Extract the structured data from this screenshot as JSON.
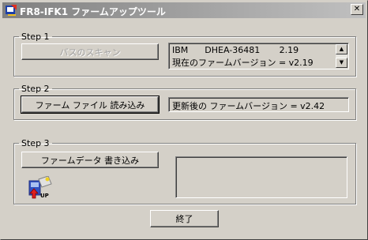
{
  "window": {
    "title": "FR8-IFK1 ファームアップツール",
    "close_glyph": "✕"
  },
  "step1": {
    "legend": "Step 1",
    "scan_button": "バスのスキャン",
    "device_info": "IBM      DHEA-36481       2.19",
    "current_firmware": "現在のファームバージョン = v2.19",
    "scroll_up": "▲",
    "scroll_down": "▼"
  },
  "step2": {
    "legend": "Step 2",
    "load_button": "ファーム ファイル 読み込み",
    "updated_firmware": "更新後の ファームバージョン = v2.42"
  },
  "step3": {
    "legend": "Step 3",
    "write_button": "ファームデータ 書き込み",
    "output_text": "",
    "icon_name": "firmware-update-icon",
    "icon_caption": "UP"
  },
  "footer": {
    "exit_button": "終了"
  }
}
